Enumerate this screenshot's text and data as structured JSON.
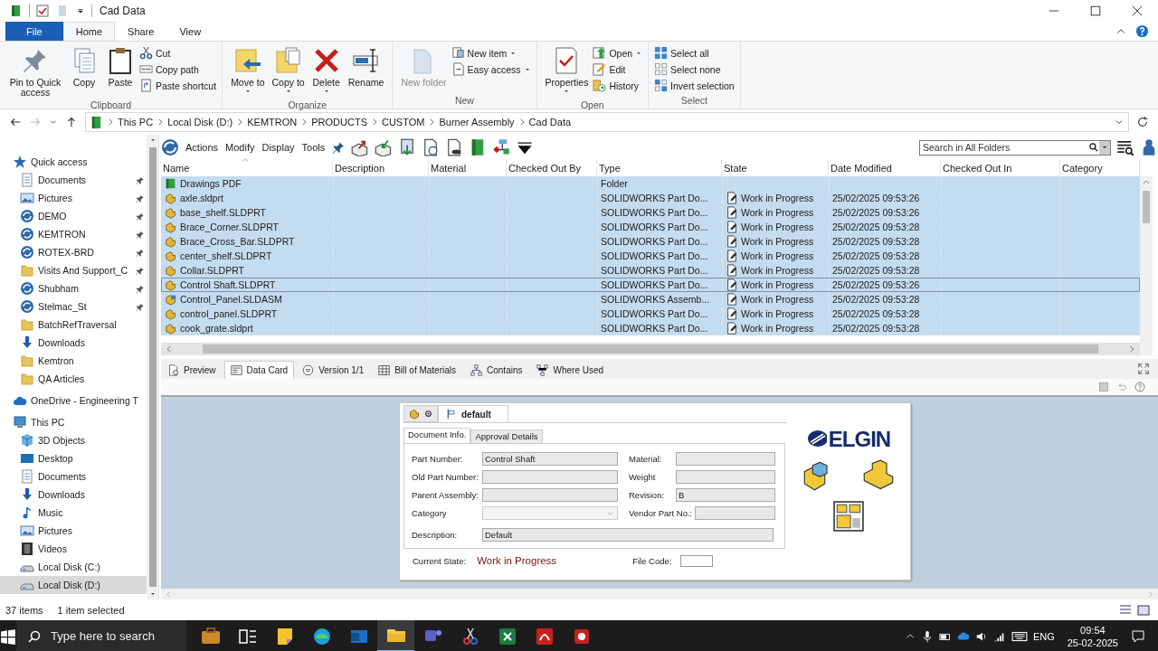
{
  "window": {
    "title": "Cad Data"
  },
  "ribbon_tabs": [
    {
      "label": "File",
      "kind": "file",
      "selected": false
    },
    {
      "label": "Home",
      "kind": "tab",
      "selected": true
    },
    {
      "label": "Share",
      "kind": "tab",
      "selected": false
    },
    {
      "label": "View",
      "kind": "tab",
      "selected": false
    }
  ],
  "ribbon_groups": [
    {
      "title": "Clipboard",
      "buttons": [
        {
          "label": "Pin to Quick access",
          "kind": "large",
          "disabled": false,
          "dropdown": false
        },
        {
          "label": "Copy",
          "kind": "large",
          "disabled": false,
          "dropdown": false
        },
        {
          "label": "Paste",
          "kind": "large",
          "disabled": false,
          "dropdown": false
        },
        {
          "label": "Cut",
          "kind": "small",
          "disabled": false,
          "dropdown": false
        },
        {
          "label": "Copy path",
          "kind": "small",
          "disabled": false,
          "dropdown": false
        },
        {
          "label": "Paste shortcut",
          "kind": "small",
          "disabled": false,
          "dropdown": false
        }
      ]
    },
    {
      "title": "Organize",
      "buttons": [
        {
          "label": "Move to",
          "kind": "large",
          "disabled": false,
          "dropdown": true
        },
        {
          "label": "Copy to",
          "kind": "large",
          "disabled": false,
          "dropdown": true
        },
        {
          "label": "Delete",
          "kind": "large",
          "disabled": false,
          "dropdown": true
        },
        {
          "label": "Rename",
          "kind": "large",
          "disabled": false,
          "dropdown": false
        }
      ]
    },
    {
      "title": "New",
      "buttons": [
        {
          "label": "New folder",
          "kind": "large",
          "disabled": true,
          "dropdown": false
        },
        {
          "label": "New item",
          "kind": "small",
          "disabled": false,
          "dropdown": true
        },
        {
          "label": "Easy access",
          "kind": "small",
          "disabled": false,
          "dropdown": true
        }
      ]
    },
    {
      "title": "Open",
      "buttons": [
        {
          "label": "Properties",
          "kind": "large",
          "disabled": false,
          "dropdown": true
        },
        {
          "label": "Open",
          "kind": "small",
          "disabled": false,
          "dropdown": true
        },
        {
          "label": "Edit",
          "kind": "small",
          "disabled": false,
          "dropdown": false
        },
        {
          "label": "History",
          "kind": "small",
          "disabled": false,
          "dropdown": false
        }
      ]
    },
    {
      "title": "Select",
      "buttons": [
        {
          "label": "Select all",
          "kind": "small",
          "disabled": false,
          "dropdown": false
        },
        {
          "label": "Select none",
          "kind": "small",
          "disabled": false,
          "dropdown": false
        },
        {
          "label": "Invert selection",
          "kind": "small",
          "disabled": false,
          "dropdown": false
        }
      ]
    }
  ],
  "address_bar": {
    "back_disabled": false,
    "forward_disabled": true,
    "path": [
      "This PC",
      "Local Disk (D:)",
      "KEMTRON",
      "PRODUCTS",
      "CUSTOM",
      "Burner Assembly",
      "Cad Data"
    ]
  },
  "sidebar": {
    "items": [
      {
        "label": "Quick access",
        "kind": "star",
        "selected": false,
        "children": [
          {
            "label": "Documents",
            "kind": "document",
            "selected": false,
            "pinned": true
          },
          {
            "label": "Pictures",
            "kind": "pictures",
            "selected": false,
            "pinned": true
          },
          {
            "label": "DEMO",
            "kind": "vault",
            "selected": false,
            "pinned": true
          },
          {
            "label": "KEMTRON",
            "kind": "vault",
            "selected": false,
            "pinned": true
          },
          {
            "label": "ROTEX-BRD",
            "kind": "vault",
            "selected": false,
            "pinned": true
          },
          {
            "label": "Visits And Support_C",
            "kind": "folder",
            "selected": false,
            "pinned": true
          },
          {
            "label": "Shubham",
            "kind": "vault",
            "selected": false,
            "pinned": true
          },
          {
            "label": "Stelmac_St",
            "kind": "vault",
            "selected": false,
            "pinned": true
          },
          {
            "label": "BatchRefTraversal",
            "kind": "folder",
            "selected": false,
            "pinned": false
          },
          {
            "label": "Downloads",
            "kind": "download",
            "selected": false,
            "pinned": false
          },
          {
            "label": "Kemtron",
            "kind": "folder",
            "selected": false,
            "pinned": false
          },
          {
            "label": "QA Articles",
            "kind": "folder",
            "selected": false,
            "pinned": false
          }
        ]
      },
      {
        "label": "OneDrive - Engineering T",
        "kind": "cloud",
        "selected": false
      },
      {
        "label": "This PC",
        "kind": "computer",
        "selected": false,
        "children": [
          {
            "label": "3D Objects",
            "kind": "objects",
            "selected": false
          },
          {
            "label": "Desktop",
            "kind": "desktop",
            "selected": false
          },
          {
            "label": "Documents",
            "kind": "document",
            "selected": false
          },
          {
            "label": "Downloads",
            "kind": "download",
            "selected": false
          },
          {
            "label": "Music",
            "kind": "music",
            "selected": false
          },
          {
            "label": "Pictures",
            "kind": "pictures",
            "selected": false
          },
          {
            "label": "Videos",
            "kind": "videos",
            "selected": false
          },
          {
            "label": "Local Disk (C:)",
            "kind": "drive",
            "selected": false
          },
          {
            "label": "Local Disk (D:)",
            "kind": "drive",
            "selected": true
          }
        ]
      }
    ]
  },
  "vault_toolbar": {
    "menus": [
      "Actions",
      "Modify",
      "Display",
      "Tools"
    ],
    "search": {
      "placeholder": "Search in All Folders"
    }
  },
  "table": {
    "columns": [
      "Name",
      "Description",
      "Material",
      "Checked Out By",
      "Type",
      "State",
      "Date Modified",
      "Checked Out In",
      "Category"
    ],
    "rows": [
      {
        "kind": "folder",
        "name": "Drawings PDF",
        "type": "Folder",
        "selected": true,
        "focused": false
      },
      {
        "kind": "part",
        "name": "axle.sldprt",
        "type": "SOLIDWORKS Part Do...",
        "state": "Work in Progress",
        "date_modified": "25/02/2025 09:53:26",
        "selected": true,
        "focused": false
      },
      {
        "kind": "part",
        "name": "base_shelf.SLDPRT",
        "type": "SOLIDWORKS Part Do...",
        "state": "Work in Progress",
        "date_modified": "25/02/2025 09:53:26",
        "selected": true,
        "focused": false
      },
      {
        "kind": "part",
        "name": "Brace_Corner.SLDPRT",
        "type": "SOLIDWORKS Part Do...",
        "state": "Work in Progress",
        "date_modified": "25/02/2025 09:53:28",
        "selected": true,
        "focused": false
      },
      {
        "kind": "part",
        "name": "Brace_Cross_Bar.SLDPRT",
        "type": "SOLIDWORKS Part Do...",
        "state": "Work in Progress",
        "date_modified": "25/02/2025 09:53:28",
        "selected": true,
        "focused": false
      },
      {
        "kind": "part",
        "name": "center_shelf.SLDPRT",
        "type": "SOLIDWORKS Part Do...",
        "state": "Work in Progress",
        "date_modified": "25/02/2025 09:53:28",
        "selected": true,
        "focused": false
      },
      {
        "kind": "part",
        "name": "Collar.SLDPRT",
        "type": "SOLIDWORKS Part Do...",
        "state": "Work in Progress",
        "date_modified": "25/02/2025 09:53:28",
        "selected": true,
        "focused": false
      },
      {
        "kind": "part",
        "name": "Control Shaft.SLDPRT",
        "type": "SOLIDWORKS Part Do...",
        "state": "Work in Progress",
        "date_modified": "25/02/2025 09:53:26",
        "selected": true,
        "focused": true
      },
      {
        "kind": "assembly",
        "name": "Control_Panel.SLDASM",
        "type": "SOLIDWORKS Assemb...",
        "state": "Work in Progress",
        "date_modified": "25/02/2025 09:53:28",
        "selected": true,
        "focused": false
      },
      {
        "kind": "part",
        "name": "control_panel.SLDPRT",
        "type": "SOLIDWORKS Part Do...",
        "state": "Work in Progress",
        "date_modified": "25/02/2025 09:53:28",
        "selected": true,
        "focused": false
      },
      {
        "kind": "part",
        "name": "cook_grate.sldprt",
        "type": "SOLIDWORKS Part Do...",
        "state": "Work in Progress",
        "date_modified": "25/02/2025 09:53:28",
        "selected": true,
        "focused": false
      }
    ]
  },
  "detail_tabs": [
    {
      "label": "Preview",
      "selected": false
    },
    {
      "label": "Data Card",
      "selected": true
    },
    {
      "label": "Version 1/1",
      "selected": false
    },
    {
      "label": "Bill of Materials",
      "selected": false
    },
    {
      "label": "Contains",
      "selected": false
    },
    {
      "label": "Where Used",
      "selected": false
    }
  ],
  "data_card": {
    "configuration": "default",
    "tabs": [
      {
        "label": "Document Info.",
        "selected": true
      },
      {
        "label": "Approval Details",
        "selected": false
      }
    ],
    "left_fields": [
      {
        "label": "Part Number:",
        "kind": "text",
        "value": "Control Shaft"
      },
      {
        "label": "Old Part Number:",
        "kind": "text"
      },
      {
        "label": "Parent Assembly:",
        "kind": "text"
      },
      {
        "label": "Category",
        "kind": "dropdown"
      }
    ],
    "right_fields": [
      {
        "label": "Material:",
        "kind": "text"
      },
      {
        "label": "Weight",
        "kind": "text"
      },
      {
        "label": "Revision:",
        "kind": "text",
        "value": "B"
      },
      {
        "label": "Vendor Part No.:",
        "kind": "short"
      }
    ],
    "description": {
      "label": "Description:",
      "value": "Default"
    },
    "current_state": {
      "label": "Current State:",
      "value": "Work in Progress"
    },
    "file_code": {
      "label": "File Code:"
    },
    "logo": "ELGIN"
  },
  "status_bar": {
    "item_count": "37 items",
    "selection": "1 item selected"
  },
  "taskbar": {
    "search_placeholder": "Type here to search",
    "apps": [
      {
        "selected": false
      },
      {
        "selected": false
      },
      {
        "selected": false
      },
      {
        "selected": false
      },
      {
        "selected": false
      },
      {
        "selected": true
      },
      {
        "selected": false
      },
      {
        "selected": false
      },
      {
        "selected": false
      },
      {
        "selected": false
      },
      {
        "selected": false
      }
    ],
    "language": "ENG",
    "time": "09:54",
    "date": "25-02-2025"
  }
}
